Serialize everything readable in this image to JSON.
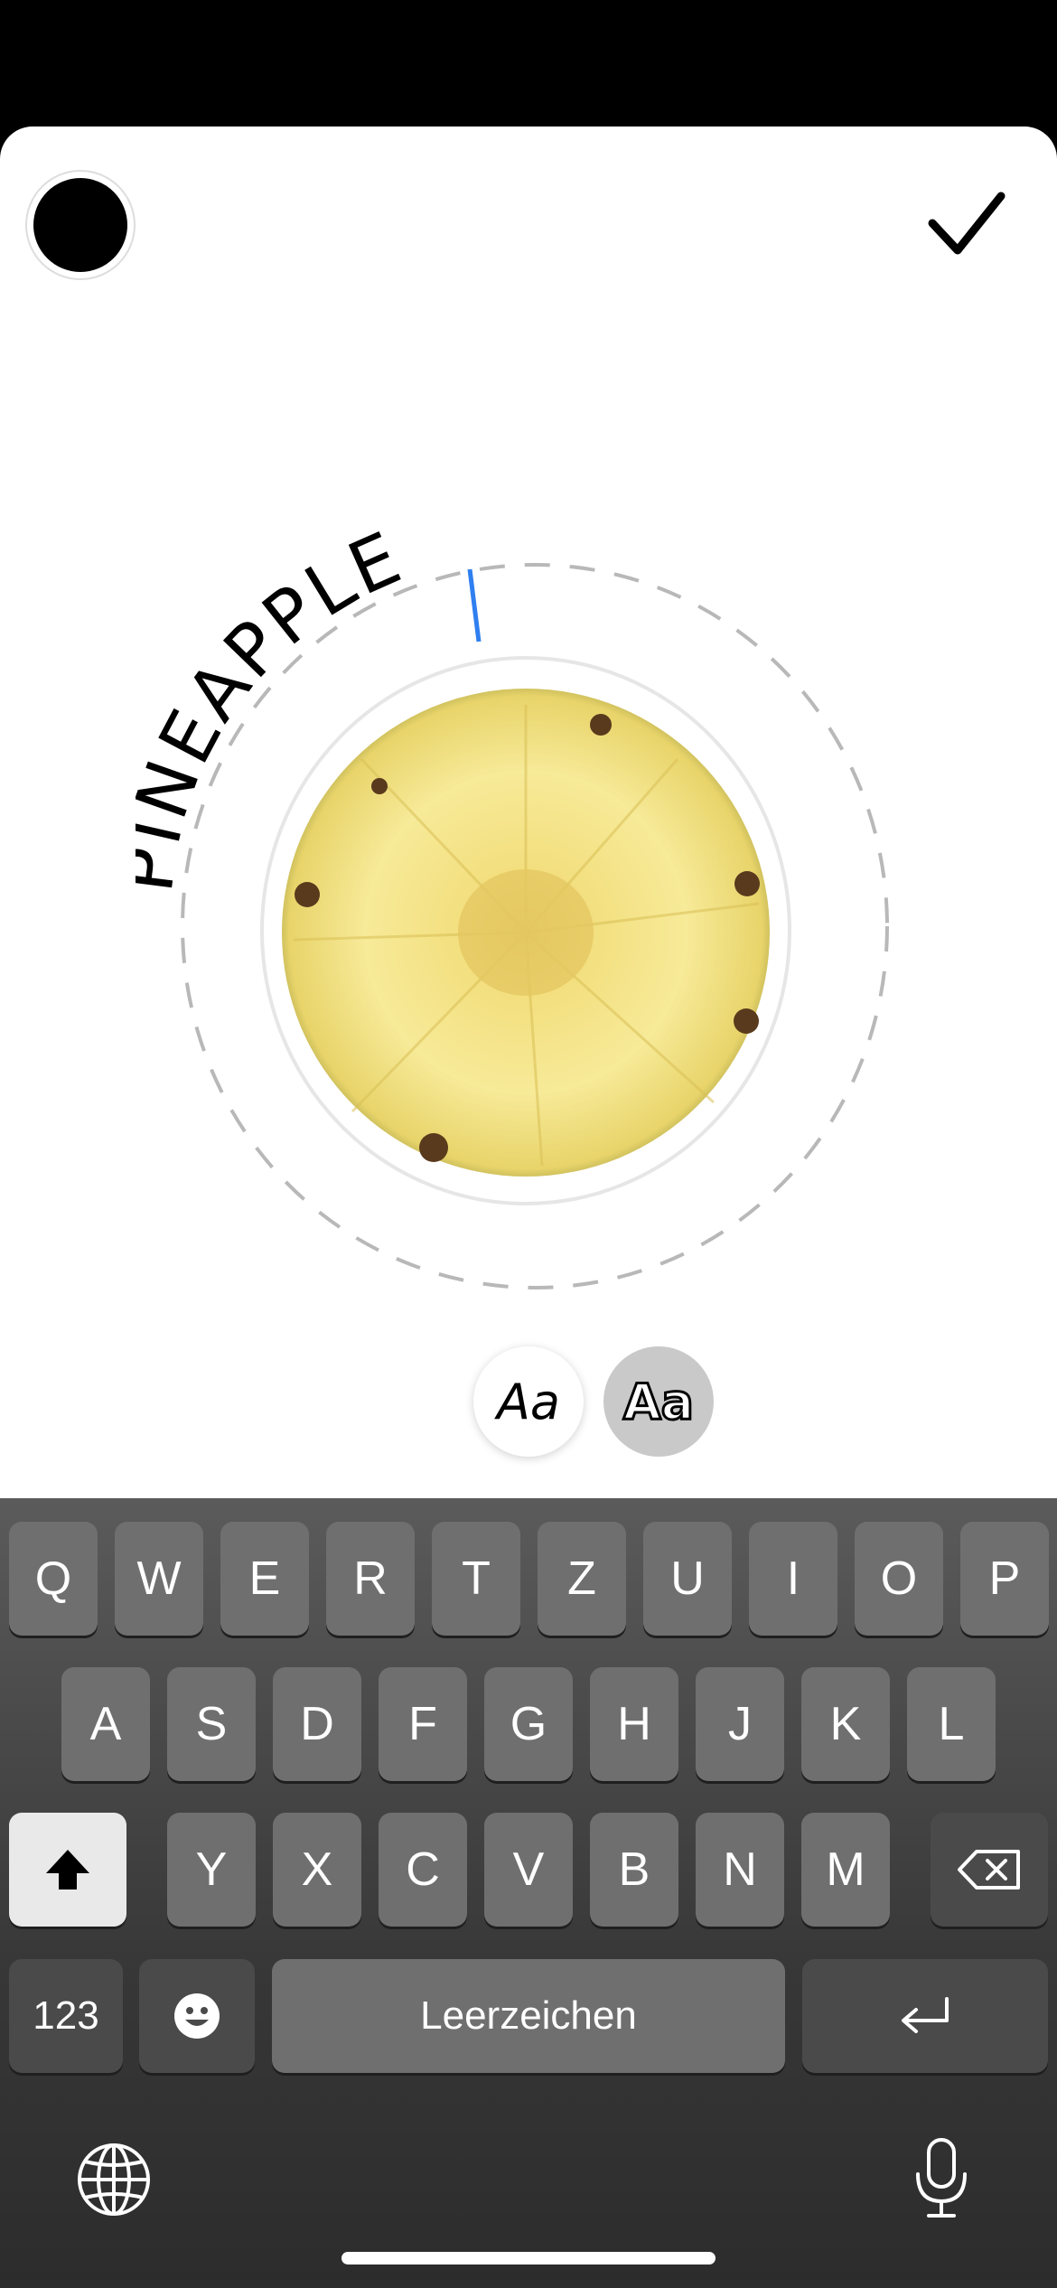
{
  "sticker": {
    "text": "PINEAPPLE",
    "subject": "pineapple slice"
  },
  "font_styles": [
    "Aa",
    "Aa"
  ],
  "keyboard": {
    "row1": [
      "Q",
      "W",
      "E",
      "R",
      "T",
      "Z",
      "U",
      "I",
      "O",
      "P"
    ],
    "row2": [
      "A",
      "S",
      "D",
      "F",
      "G",
      "H",
      "J",
      "K",
      "L"
    ],
    "row3": [
      "Y",
      "X",
      "C",
      "V",
      "B",
      "N",
      "M"
    ],
    "numbers_key": "123",
    "space_label": "Leerzeichen"
  },
  "icons": [
    "checkmark-icon",
    "shift-icon",
    "backspace-icon",
    "emoji-icon",
    "return-icon",
    "globe-icon",
    "microphone-icon"
  ],
  "colors": {
    "selected_text_color": "#000000",
    "cursor": "#2f7ff0"
  }
}
